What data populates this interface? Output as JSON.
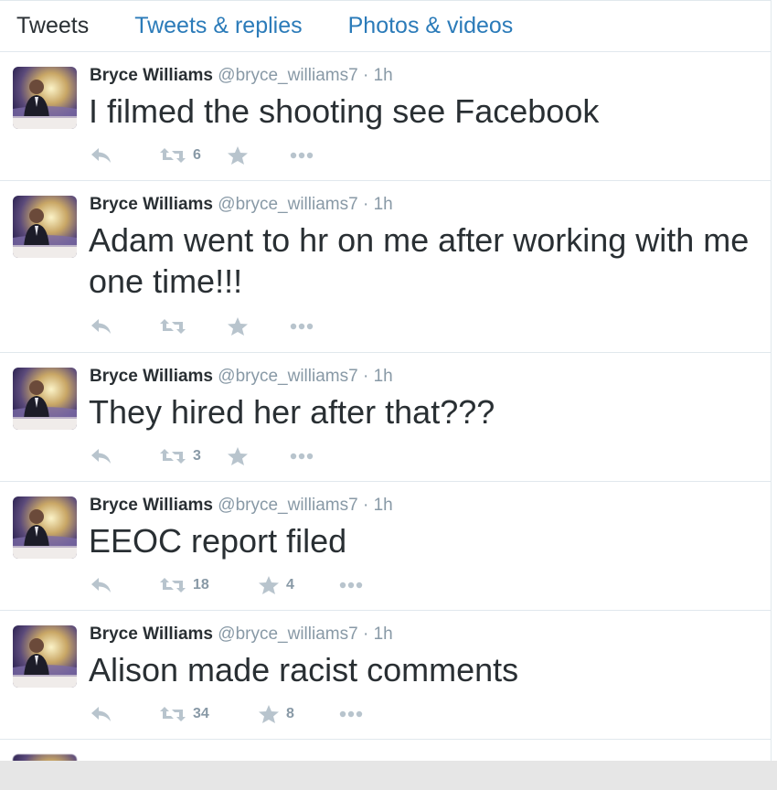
{
  "tabs": [
    {
      "label": "Tweets",
      "active": true
    },
    {
      "label": "Tweets & replies",
      "active": false
    },
    {
      "label": "Photos & videos",
      "active": false
    }
  ],
  "tweets": [
    {
      "fullname": "Bryce Williams",
      "username": "@bryce_williams7",
      "separator": "·",
      "time": "1h",
      "text": "I filmed the shooting see Facebook",
      "retweets": "6",
      "favorites": ""
    },
    {
      "fullname": "Bryce Williams",
      "username": "@bryce_williams7",
      "separator": "·",
      "time": "1h",
      "text": "Adam went to hr on me after working with me one time!!!",
      "retweets": "",
      "favorites": ""
    },
    {
      "fullname": "Bryce Williams",
      "username": "@bryce_williams7",
      "separator": "·",
      "time": "1h",
      "text": "They hired her after that???",
      "retweets": "3",
      "favorites": ""
    },
    {
      "fullname": "Bryce Williams",
      "username": "@bryce_williams7",
      "separator": "·",
      "time": "1h",
      "text": "EEOC report filed",
      "retweets": "18",
      "favorites": "4"
    },
    {
      "fullname": "Bryce Williams",
      "username": "@bryce_williams7",
      "separator": "·",
      "time": "1h",
      "text": "Alison made racist comments",
      "retweets": "34",
      "favorites": "8"
    }
  ],
  "icons": {
    "reply": "reply-icon",
    "retweet": "retweet-icon",
    "favorite": "star-icon",
    "more": "more-icon"
  },
  "colors": {
    "link": "#2b7bb9",
    "text": "#292f33",
    "muted": "#8899a6",
    "icon": "#b8c4cd",
    "border": "#e1e8ed"
  }
}
